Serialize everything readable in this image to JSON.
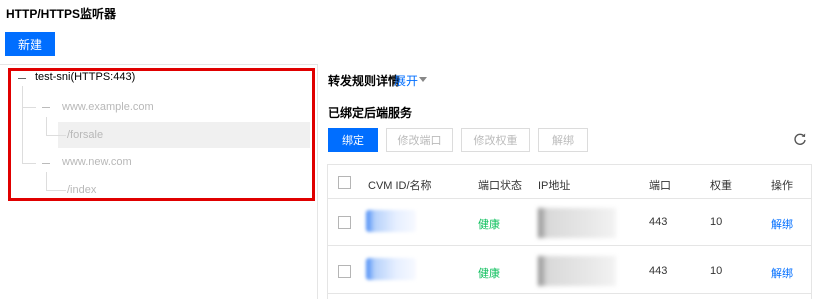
{
  "header": {
    "title": "HTTP/HTTPS监听器",
    "new_button": "新建"
  },
  "tree": {
    "root": "test-sni(HTTPS:443)",
    "domains": [
      {
        "name": "www.example.com",
        "paths": [
          "/forsale"
        ]
      },
      {
        "name": "www.new.com",
        "paths": [
          "/index"
        ]
      }
    ]
  },
  "detail": {
    "title": "转发规则详情",
    "expand_label": "展开",
    "bound_title": "已绑定后端服务",
    "buttons": {
      "bind": "绑定",
      "edit_port": "修改端口",
      "edit_weight": "修改权重",
      "unbind": "解绑"
    }
  },
  "table": {
    "columns": [
      "CVM ID/名称",
      "端口状态",
      "IP地址",
      "端口",
      "权重",
      "操作"
    ],
    "rows": [
      {
        "status": "健康",
        "port": "443",
        "weight": "10",
        "action": "解绑"
      },
      {
        "status": "健康",
        "port": "443",
        "weight": "10",
        "action": "解绑"
      }
    ]
  },
  "colors": {
    "primary": "#006eff",
    "healthy": "#0abf5b",
    "highlight": "#e00000"
  }
}
